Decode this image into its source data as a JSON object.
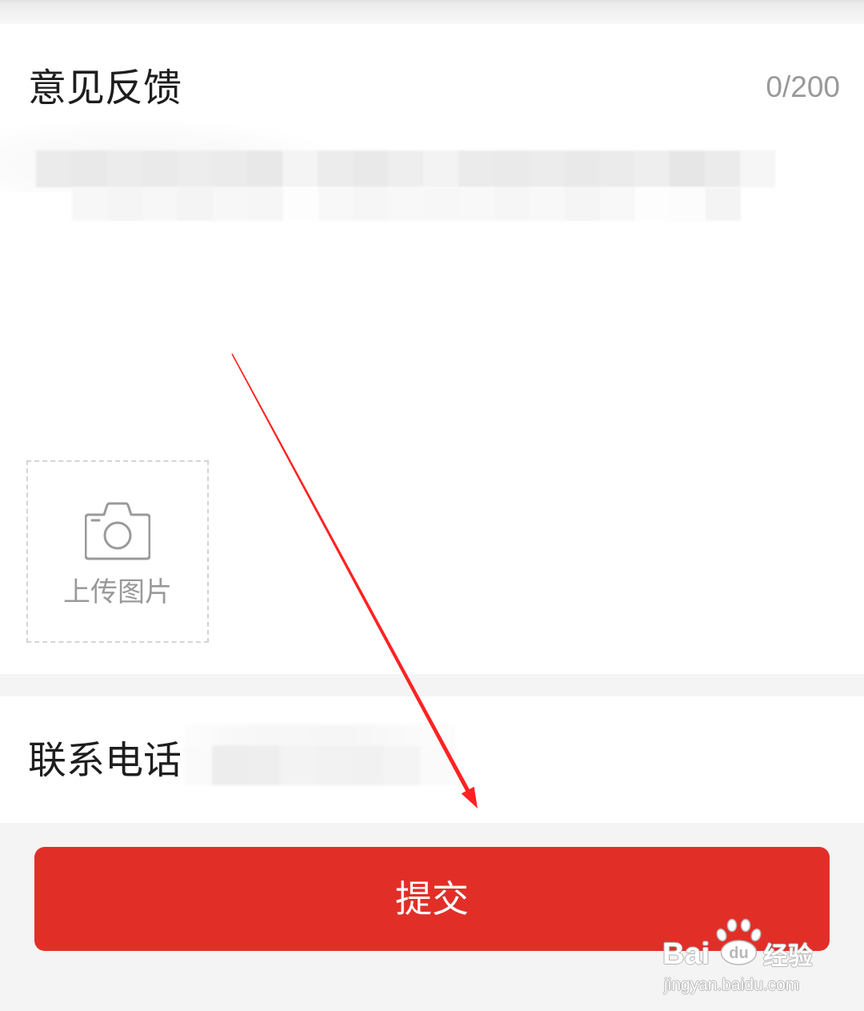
{
  "feedback": {
    "title": "意见反馈",
    "counter": "0/200",
    "upload_label": "上传图片",
    "upload_icon": "camera-icon"
  },
  "contact": {
    "label": "联系电话"
  },
  "submit": {
    "label": "提交"
  },
  "colors": {
    "accent": "#e12f28",
    "annotation": "#ff2222",
    "muted_text": "#999999",
    "page_background": "#f4f4f4"
  },
  "watermark": {
    "brand_left": "Bai",
    "brand_logo_text": "du",
    "brand_right": "经验",
    "url": "jingyan.baidu.com"
  }
}
